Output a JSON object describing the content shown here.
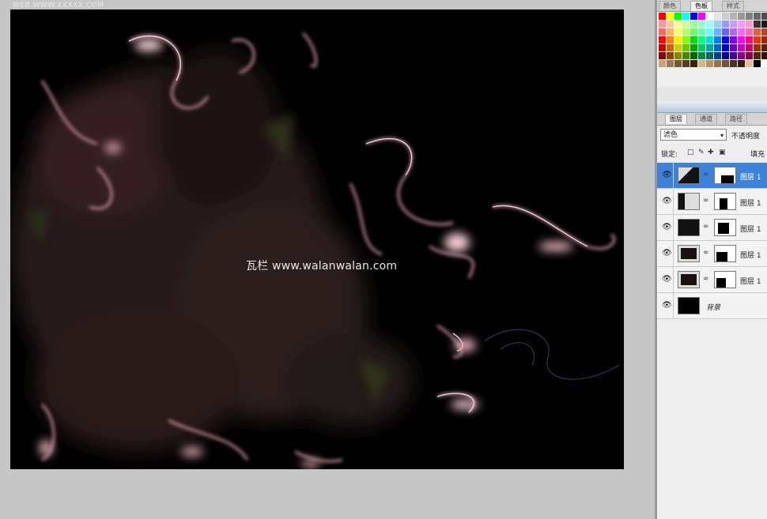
{
  "canvas": {
    "top_text": "WEB WWW.XXXXX.COM",
    "watermark": "瓦栏 www.walanwalan.com"
  },
  "swatches_panel": {
    "tabs": [
      "颜色",
      "色板",
      "样式"
    ],
    "active_tab_index": 1,
    "colors": [
      "#ff0000",
      "#ffff00",
      "#00ff00",
      "#00ffff",
      "#0000ff",
      "#ff00ff",
      "#ffffff",
      "#e6e6e6",
      "#cccccc",
      "#b3b3b3",
      "#999999",
      "#808080",
      "#666666",
      "#4d4d4d",
      "#ff9999",
      "#ffcc99",
      "#ffff99",
      "#ccff99",
      "#99ff99",
      "#99ffcc",
      "#99ffff",
      "#99ccff",
      "#9999ff",
      "#cc99ff",
      "#ff99ff",
      "#ff99cc",
      "#333333",
      "#1a1a1a",
      "#ff6666",
      "#ffb366",
      "#ffff66",
      "#b3ff66",
      "#66ff66",
      "#66ffb3",
      "#66ffff",
      "#66b3ff",
      "#6666ff",
      "#b366ff",
      "#ff66ff",
      "#ff66b3",
      "#e06040",
      "#c04020",
      "#ff0000",
      "#ff8000",
      "#ffee00",
      "#80ff00",
      "#00dd00",
      "#00ff80",
      "#00e0e0",
      "#0080ff",
      "#0000ff",
      "#8000ff",
      "#ff00ff",
      "#ff0080",
      "#ee3300",
      "#aa2200",
      "#cc0000",
      "#cc6600",
      "#cccc00",
      "#66cc00",
      "#00aa00",
      "#00cc66",
      "#00aaaa",
      "#0066cc",
      "#0000cc",
      "#6600cc",
      "#cc00cc",
      "#cc0066",
      "#993300",
      "#661a00",
      "#880000",
      "#884400",
      "#888800",
      "#448800",
      "#006600",
      "#008844",
      "#006666",
      "#004488",
      "#000088",
      "#440088",
      "#880088",
      "#880044",
      "#552200",
      "#331100",
      "#c8a27a",
      "#a0784e",
      "#7a5530",
      "#5a3a18",
      "#3a2208",
      "#d8b488",
      "#b89068",
      "#987050",
      "#785038",
      "#503020",
      "#302010",
      "#e0c090",
      "#000000",
      "#ffffff"
    ]
  },
  "layers_panel": {
    "tabs": [
      "图层",
      "通道",
      "路径"
    ],
    "active_tab_index": 0,
    "blend_mode": "滤色",
    "opacity_label": "不透明度",
    "lock_label": "锁定:",
    "fill_label": "填充",
    "layers": [
      {
        "name": "图层 1",
        "selected": true
      },
      {
        "name": "图层 1",
        "selected": false
      },
      {
        "name": "图层 1",
        "selected": false
      },
      {
        "name": "图层 1",
        "selected": false
      },
      {
        "name": "图层 1",
        "selected": false
      }
    ],
    "background_layer_name": "背景"
  }
}
